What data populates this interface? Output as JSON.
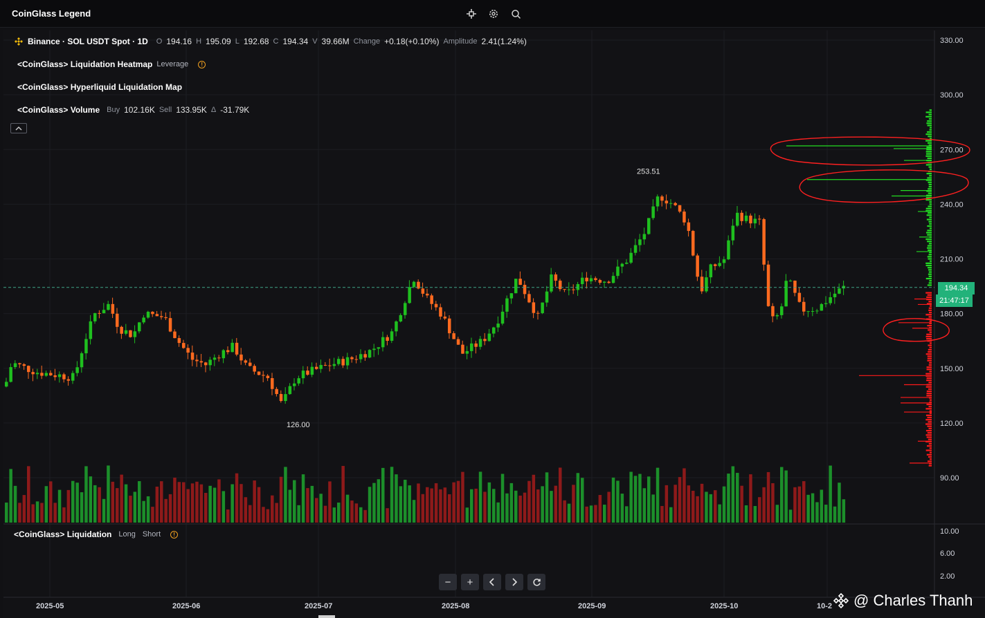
{
  "app": {
    "title": "CoinGlass Legend"
  },
  "symbol": {
    "name": "Binance · SOL USDT Spot · 1D",
    "o_label": "O",
    "o": "194.16",
    "h_label": "H",
    "h": "195.09",
    "l_label": "L",
    "l": "192.68",
    "c_label": "C",
    "c": "194.34",
    "v_label": "V",
    "v": "39.66M",
    "change_label": "Change",
    "change": "+0.18(+0.10%)",
    "amp_label": "Amplitude",
    "amplitude": "2.41(1.24%)"
  },
  "indicators": [
    {
      "name": "<CoinGlass> Liquidation Heatmap",
      "param": "Leverage"
    },
    {
      "name": "<CoinGlass> Hyperliquid Liquidation Map"
    },
    {
      "name": "<CoinGlass> Volume",
      "buy_label": "Buy",
      "buy": "102.16K",
      "sell_label": "Sell",
      "sell": "133.95K",
      "delta_label": "Δ",
      "delta": "-31.79K"
    }
  ],
  "liquidation_pane": {
    "name": "<CoinGlass> Liquidation",
    "long_label": "Long",
    "short_label": "Short",
    "yticks": [
      "10.00",
      "6.00",
      "2.00"
    ]
  },
  "price_axis": {
    "ticks": [
      "330.00",
      "300.00",
      "270.00",
      "240.00",
      "210.00",
      "180.00",
      "150.00",
      "120.00",
      "90.00"
    ]
  },
  "last_price": {
    "price": "194.34",
    "countdown": "21:47:17"
  },
  "annotations": {
    "high": "253.51",
    "low": "126.00"
  },
  "time_axis": {
    "labels": [
      "2025-05",
      "2025-06",
      "2025-07",
      "2025-08",
      "2025-09",
      "2025-10",
      "10-2"
    ]
  },
  "watermark": "@ Charles Thanh",
  "colors": {
    "up": "#1fbf1f",
    "down": "#ff6a1f",
    "vol_up": "#1c8f2a",
    "vol_down": "#8e1a1a",
    "long_liq": "#ff1a1a",
    "short_liq": "#22dd22",
    "marker": "#ff2020",
    "price_tag": "#22b27a"
  },
  "icons": [
    "crosshair-icon",
    "settings-icon",
    "search-icon",
    "chevron-up-icon",
    "minus-icon",
    "plus-icon",
    "chevron-left-icon",
    "chevron-right-icon",
    "refresh-icon",
    "binance-logo-icon"
  ]
}
